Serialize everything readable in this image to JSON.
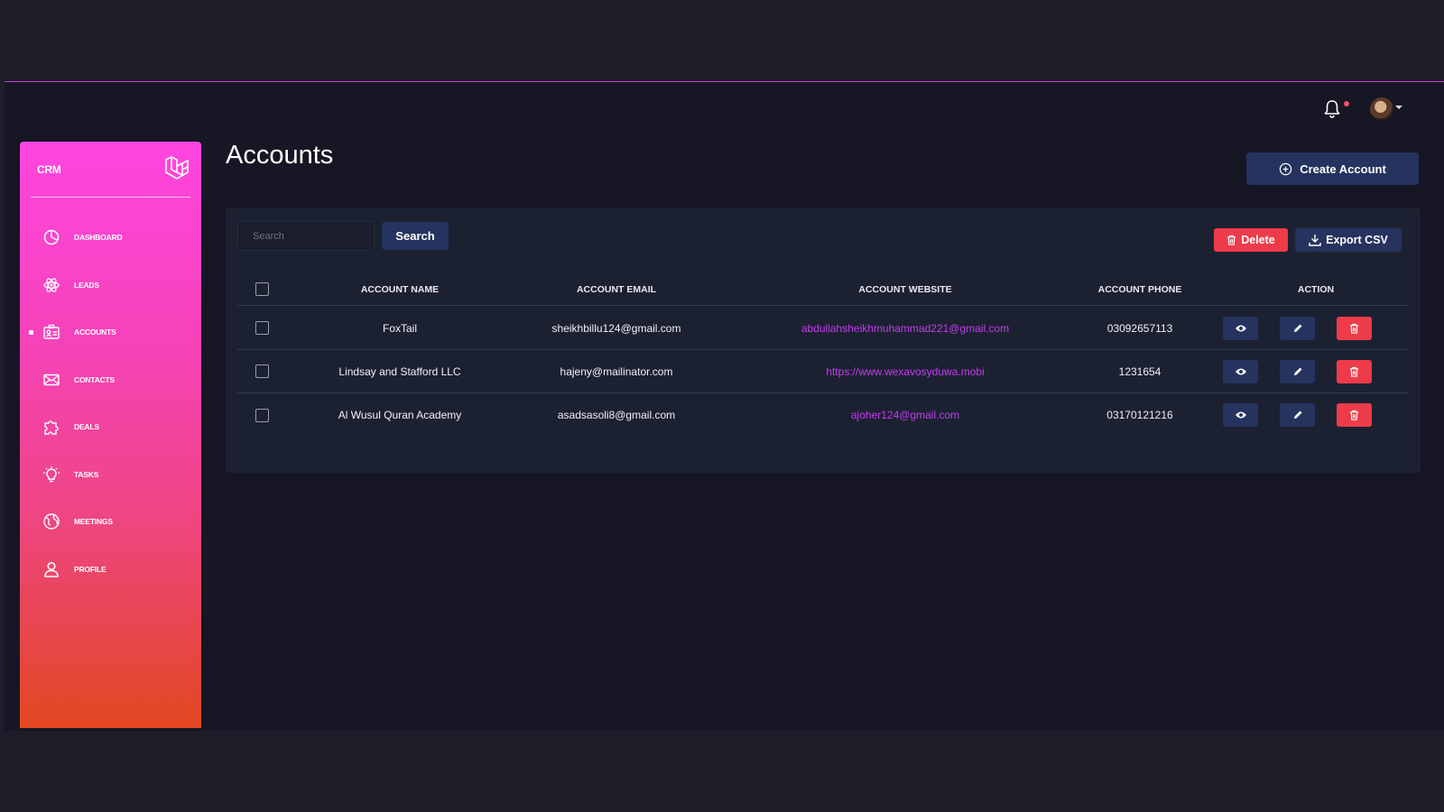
{
  "app": {
    "brand": "CRM"
  },
  "sidebar": {
    "items": [
      {
        "label": "DASHBOARD",
        "icon": "chart-pie-icon",
        "active": false
      },
      {
        "label": "LEADS",
        "icon": "atom-icon",
        "active": false
      },
      {
        "label": "ACCOUNTS",
        "icon": "id-card-icon",
        "active": true
      },
      {
        "label": "CONTACTS",
        "icon": "envelope-icon",
        "active": false
      },
      {
        "label": "DEALS",
        "icon": "puzzle-icon",
        "active": false
      },
      {
        "label": "TASKS",
        "icon": "lightbulb-icon",
        "active": false
      },
      {
        "label": "MEETINGS",
        "icon": "globe-icon",
        "active": false
      },
      {
        "label": "PROFILE",
        "icon": "user-icon",
        "active": false
      }
    ]
  },
  "topbar": {
    "notification_icon": "bell-icon",
    "has_notification": true
  },
  "page": {
    "title": "Accounts",
    "create_button": "Create Account"
  },
  "toolbar": {
    "search_placeholder": "Search",
    "search_button": "Search",
    "delete_button": "Delete",
    "export_button": "Export CSV"
  },
  "table": {
    "headers": {
      "name": "ACCOUNT NAME",
      "email": "ACCOUNT EMAIL",
      "website": "ACCOUNT WEBSITE",
      "phone": "ACCOUNT PHONE",
      "action": "ACTION"
    },
    "rows": [
      {
        "name": "FoxTail",
        "email": "sheikhbillu124@gmail.com",
        "website": "abdullahsheikhmuhammad221@gmail.com",
        "phone": "03092657113"
      },
      {
        "name": "Lindsay and Stafford LLC",
        "email": "hajeny@mailinator.com",
        "website": "https://www.wexavosyduwa.mobi",
        "phone": "1231654"
      },
      {
        "name": "Al Wusul Quran Academy",
        "email": "asadsasoli8@gmail.com",
        "website": "ajoher124@gmail.com",
        "phone": "03170121216"
      }
    ]
  },
  "colors": {
    "accent_pink": "#ff45e0",
    "accent_orange": "#e2471f",
    "button_navy": "#25335e",
    "danger_red": "#ee3b4a",
    "link_purple": "#c43bf0"
  }
}
